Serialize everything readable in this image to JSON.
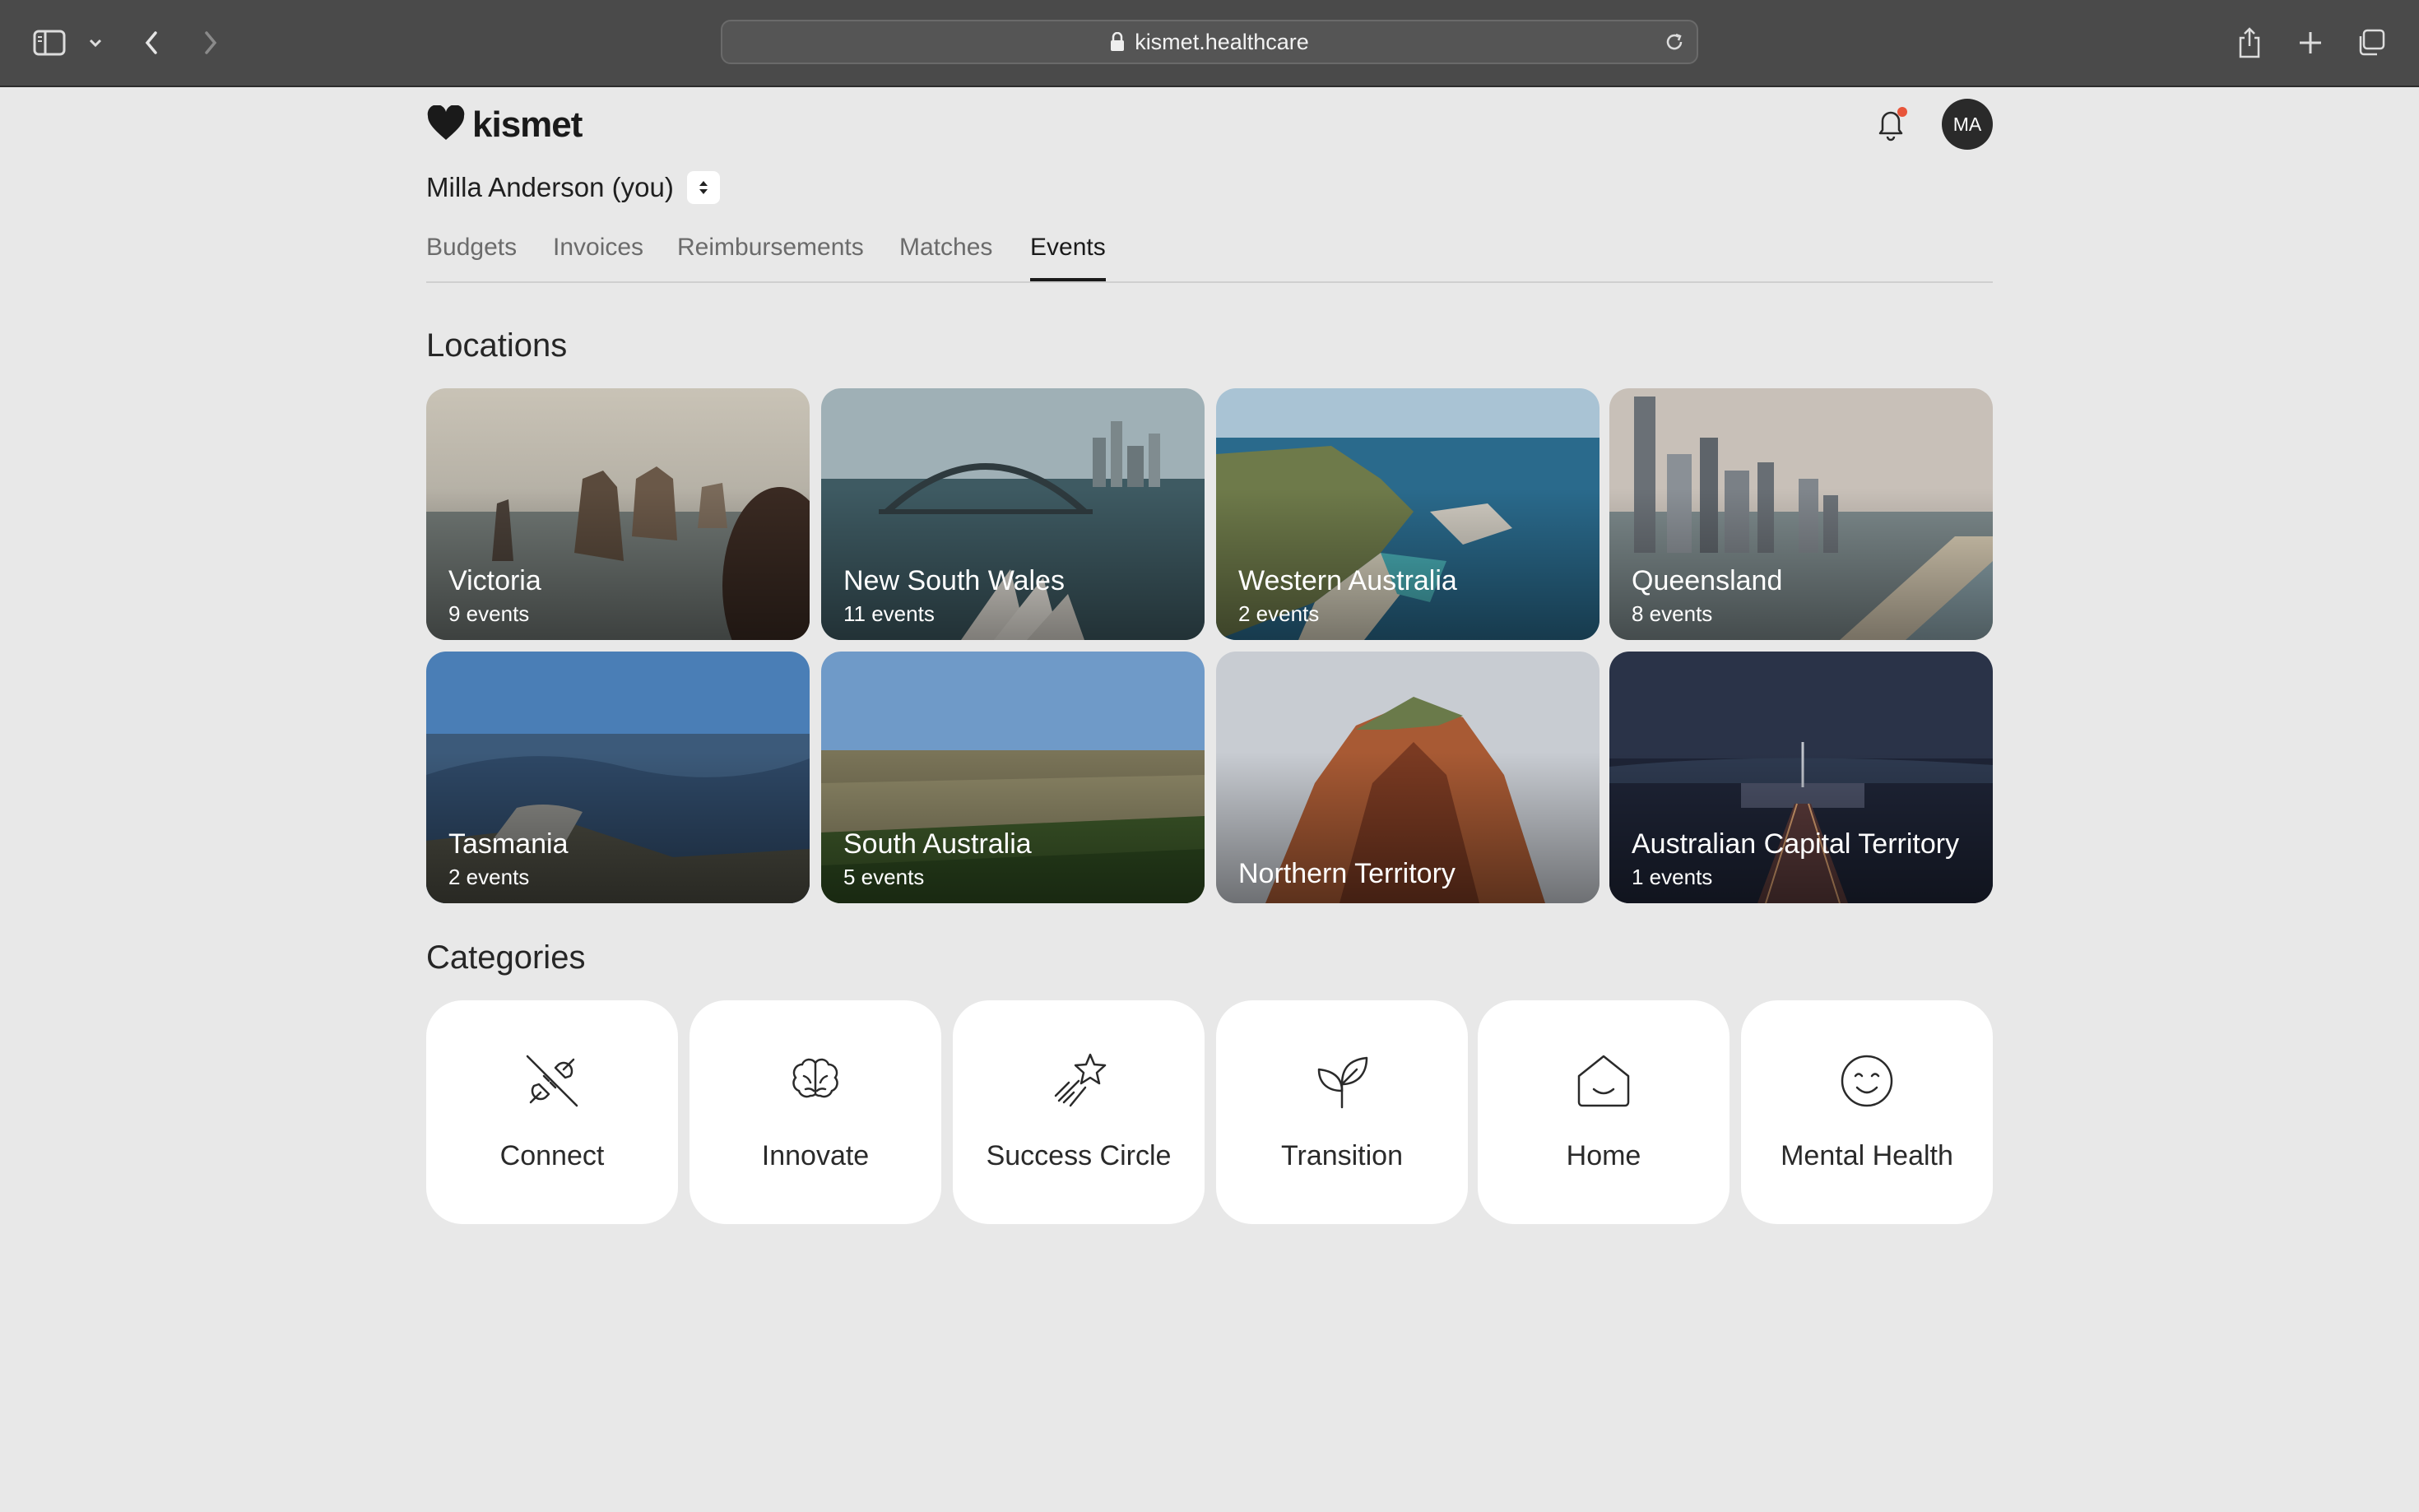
{
  "browser": {
    "url": "kismet.healthcare"
  },
  "app": {
    "logo_text": "kismet",
    "avatar_initials": "MA",
    "user_name": "Milla Anderson (you)"
  },
  "tabs": [
    {
      "label": "Budgets",
      "active": false
    },
    {
      "label": "Invoices",
      "active": false
    },
    {
      "label": "Reimbursements",
      "active": false
    },
    {
      "label": "Matches",
      "active": false
    },
    {
      "label": "Events",
      "active": true
    }
  ],
  "locations": {
    "title": "Locations",
    "items": [
      {
        "name": "Victoria",
        "count": "9 events",
        "scene": "coastal-rock-stacks"
      },
      {
        "name": "New South Wales",
        "count": "11 events",
        "scene": "harbour-bridge-opera-house"
      },
      {
        "name": "Western Australia",
        "count": "2 events",
        "scene": "coastline-aerial"
      },
      {
        "name": "Queensland",
        "count": "8 events",
        "scene": "beach-skyline"
      },
      {
        "name": "Tasmania",
        "count": "2 events",
        "scene": "mountain-lookout"
      },
      {
        "name": "South Australia",
        "count": "5 events",
        "scene": "vineyard"
      },
      {
        "name": "Northern Territory",
        "count": "",
        "scene": "red-rock-outcrop"
      },
      {
        "name": "Australian Capital Territory",
        "count": "1 events",
        "scene": "parliament-night"
      }
    ]
  },
  "categories": {
    "title": "Categories",
    "items": [
      {
        "label": "Connect",
        "icon": "plug-icon"
      },
      {
        "label": "Innovate",
        "icon": "brain-icon"
      },
      {
        "label": "Success Circle",
        "icon": "shooting-star-icon"
      },
      {
        "label": "Transition",
        "icon": "sprout-icon"
      },
      {
        "label": "Home",
        "icon": "home-icon"
      },
      {
        "label": "Mental Health",
        "icon": "smile-icon"
      }
    ]
  },
  "colors": {
    "page_bg": "#e8e8e8",
    "chrome_bg": "#4a4a4a",
    "notification_dot": "#e8553a",
    "avatar_bg": "#2a2a2a"
  }
}
